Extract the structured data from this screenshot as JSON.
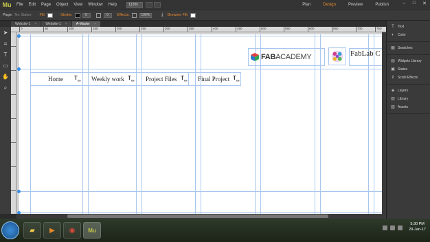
{
  "app": {
    "logo": "Mu",
    "menu": [
      "File",
      "Edit",
      "Page",
      "Object",
      "View",
      "Window",
      "Help"
    ],
    "zoom": "113%",
    "modes": [
      {
        "label": "Plan",
        "active": false
      },
      {
        "label": "Design",
        "active": true
      },
      {
        "label": "Preview",
        "active": false
      },
      {
        "label": "Publish",
        "active": false
      }
    ],
    "window_controls": [
      "–",
      "□",
      "✕"
    ]
  },
  "control_bar": {
    "page_label": "Page:",
    "page_value": "No States",
    "fill_label": "Fill:",
    "stroke_label": "Stroke:",
    "stroke_value": "0",
    "corner_value": "0",
    "effects_label": "Effects:",
    "opacity_value": "100%",
    "browser_fill_label": "Browser Fill:"
  },
  "tabs": [
    {
      "label": "Website-1",
      "active": false
    },
    {
      "label": "Website-1",
      "active": false
    },
    {
      "label": "A-Master",
      "active": true
    }
  ],
  "tools": [
    "selection-icon",
    "crop-icon",
    "text-icon",
    "rectangle-icon",
    "hand-icon",
    "zoom-icon"
  ],
  "ruler_ticks": [
    "0",
    "50",
    "100",
    "150",
    "200",
    "250",
    "300",
    "350",
    "400",
    "450",
    "500",
    "550",
    "600",
    "650",
    "700",
    "750"
  ],
  "canvas": {
    "nav": [
      "Home",
      "Weekly work",
      "Project Files",
      "Final Project"
    ],
    "fab_logo": {
      "bold": "FAB",
      "light": "ACADEMY"
    },
    "fablab_text": "FabLab C"
  },
  "panels": [
    {
      "items": [
        {
          "icon": "text-panel-icon",
          "label": "Text"
        },
        {
          "icon": "color-panel-icon",
          "label": "Color"
        }
      ]
    },
    {
      "items": [
        {
          "icon": "swatches-panel-icon",
          "label": "Swatches"
        }
      ]
    },
    {
      "items": [
        {
          "icon": "widgets-panel-icon",
          "label": "Widgets Library"
        },
        {
          "icon": "states-panel-icon",
          "label": "States"
        },
        {
          "icon": "scroll-effects-panel-icon",
          "label": "Scroll Effects"
        }
      ]
    },
    {
      "items": [
        {
          "icon": "layers-panel-icon",
          "label": "Layers"
        },
        {
          "icon": "library-panel-icon",
          "label": "Library"
        },
        {
          "icon": "assets-panel-icon",
          "label": "Assets"
        }
      ]
    }
  ],
  "taskbar": {
    "apps": [
      "folder",
      "media",
      "chrome",
      "muse"
    ],
    "time": "5:30 PM",
    "date": "29-Jan-17"
  },
  "colors": {
    "accent": "#e8892c",
    "guide": "#a9c7ee",
    "chrome": "#3a3a3a"
  }
}
